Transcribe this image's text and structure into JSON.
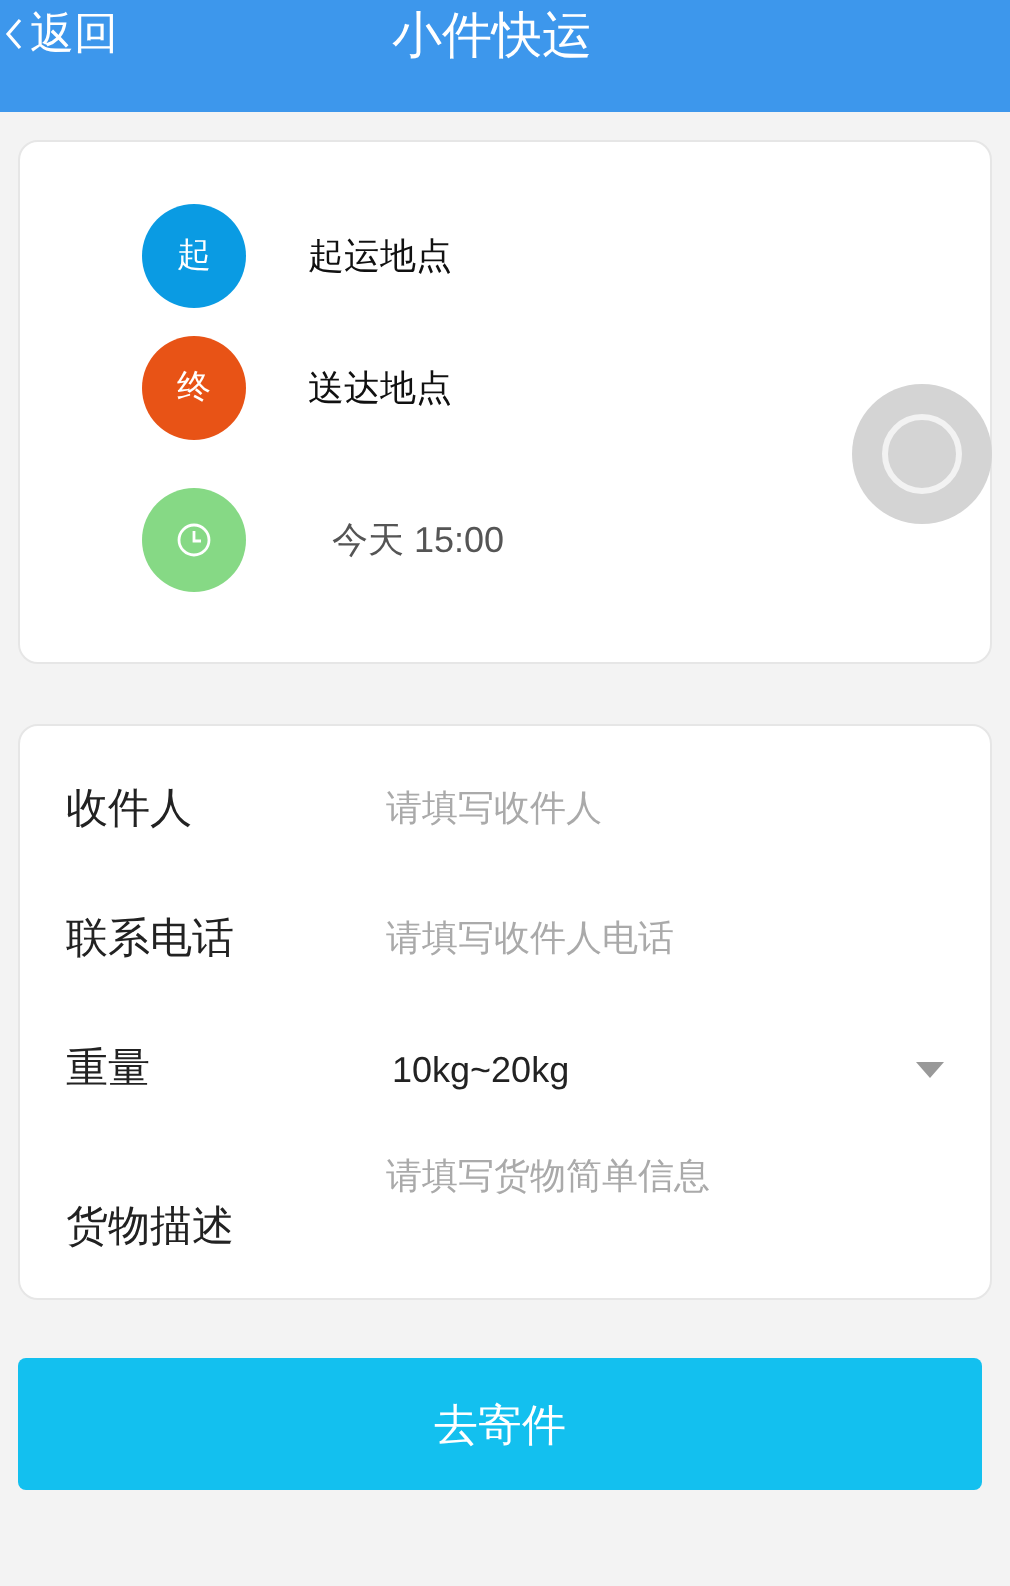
{
  "header": {
    "back": "返回",
    "title": "小件快运"
  },
  "route": [
    {
      "kind": "origin",
      "badge": "起",
      "label": "起运地点",
      "color": "#0a9be3"
    },
    {
      "kind": "destination",
      "badge": "终",
      "label": "送达地点",
      "color": "#e85316"
    },
    {
      "kind": "time",
      "label": "今天 15:00",
      "color": "#86d985"
    }
  ],
  "form": [
    {
      "kind": "text",
      "label": "收件人",
      "placeholder": "请填写收件人"
    },
    {
      "kind": "text",
      "label": "联系电话",
      "placeholder": "请填写收件人电话"
    },
    {
      "kind": "select",
      "label": "重量",
      "value": "10kg~20kg"
    },
    {
      "kind": "textarea",
      "label": "货物描述",
      "placeholder": "请填写货物简单信息"
    }
  ],
  "submit": "去寄件"
}
